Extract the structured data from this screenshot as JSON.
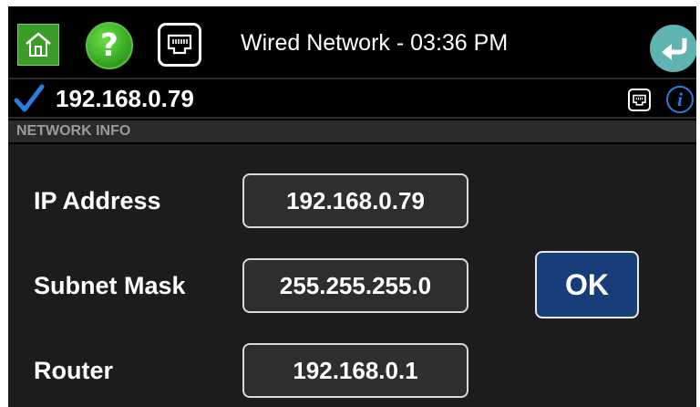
{
  "header": {
    "title": "Wired Network - 03:36 PM",
    "home_icon": "home-icon",
    "help_label": "?",
    "network_icon": "ethernet-port-icon",
    "back_icon": "back-arrow-icon"
  },
  "status": {
    "ip": "192.168.0.79",
    "connected_icon": "checkmark-icon",
    "info_label": "i",
    "accent": "#2b7de0"
  },
  "section": {
    "title": "NETWORK INFO"
  },
  "fields": {
    "ip_label": "IP Address",
    "ip_value": "192.168.0.79",
    "subnet_label": "Subnet Mask",
    "subnet_value": "255.255.255.0",
    "router_label": "Router",
    "router_value": "192.168.0.1"
  },
  "actions": {
    "ok_label": "OK"
  },
  "colors": {
    "home_button": "#3d9b2a",
    "help_button": "#2f9e1c",
    "back_button": "#5fb3b0",
    "ok_button": "#173e78"
  }
}
